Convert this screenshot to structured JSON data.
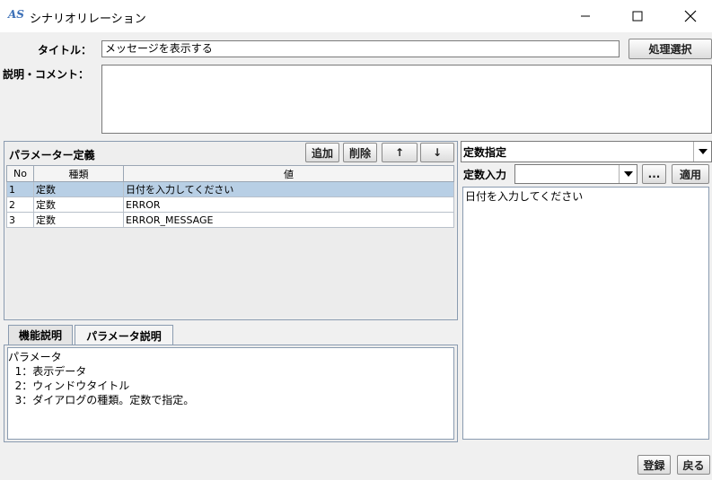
{
  "window": {
    "title": "シナリオリレーション",
    "app_icon_text": "AS"
  },
  "form": {
    "title_label": "タイトル：",
    "title_value": "メッセージを表示する",
    "select_button": "処理選択",
    "comment_label": "説明・コメント：",
    "comment_value": ""
  },
  "params": {
    "panel_title": "パラメーター定義",
    "add_button": "追加",
    "delete_button": "削除",
    "up_button": "↑",
    "down_button": "↓",
    "columns": [
      "No",
      "種類",
      "値"
    ],
    "rows": [
      {
        "no": "1",
        "kind": "定数",
        "value": "日付を入力してください"
      },
      {
        "no": "2",
        "kind": "定数",
        "value": "ERROR"
      },
      {
        "no": "3",
        "kind": "定数",
        "value": "ERROR_MESSAGE"
      }
    ],
    "selected_row": 1
  },
  "tabs": {
    "items": [
      "機能説明",
      "パラメータ説明"
    ],
    "active_index": 1,
    "content_lines": [
      "パラメータ",
      "  1：表示データ",
      "  2：ウィンドウタイトル",
      "  3：ダイアログの種類。定数で指定。"
    ]
  },
  "constant": {
    "mode_select": "定数指定",
    "input_label": "定数入力",
    "input_select_value": "",
    "ellipsis_button": "...",
    "apply_button": "適用",
    "content_value": "日付を入力してください"
  },
  "footer": {
    "register_button": "登録",
    "back_button": "戻る"
  },
  "colors": {
    "selection": "#b8cfe5",
    "panel_border": "#8a9bb0",
    "icon_blue": "#3b6fb6"
  }
}
